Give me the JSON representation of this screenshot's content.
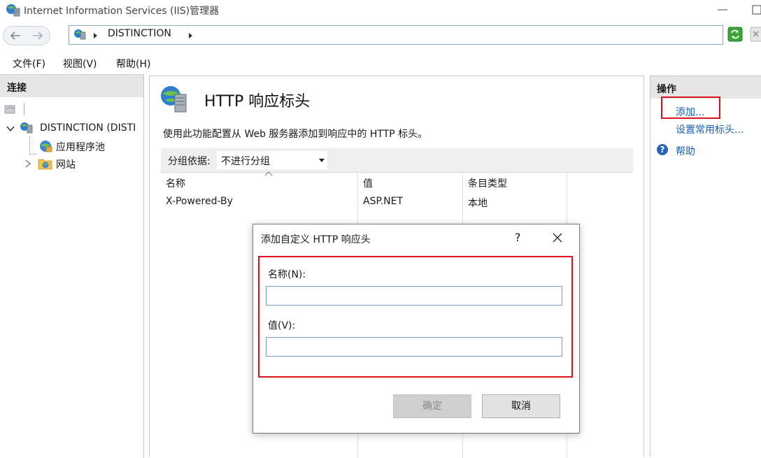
{
  "window": {
    "title": "Internet Information Services (IIS)管理器"
  },
  "address": {
    "segment": "DISTINCTION"
  },
  "menu": [
    "文件(F)",
    "视图(V)",
    "帮助(H)"
  ],
  "connections": {
    "header": "连接",
    "tree": [
      {
        "label": "DISTINCTION (DISTI",
        "expanded": true
      },
      {
        "label": "应用程序池"
      },
      {
        "label": "网站",
        "expanded": false
      }
    ]
  },
  "main": {
    "title": "HTTP 响应标头",
    "description": "使用此功能配置从 Web 服务器添加到响应中的 HTTP 标头。",
    "group_by_label": "分组依据:",
    "group_by_value": "不进行分组",
    "columns": [
      "名称",
      "值",
      "条目类型"
    ],
    "rows": [
      {
        "name": "X-Powered-By",
        "value": "ASP.NET",
        "type": "本地"
      }
    ]
  },
  "actions": {
    "header": "操作",
    "add": "添加...",
    "set_common": "设置常用标头...",
    "help": "帮助"
  },
  "dialog": {
    "title": "添加自定义 HTTP 响应头",
    "help_glyph": "?",
    "name_label": "名称(N):",
    "name_value": "",
    "value_label": "值(V):",
    "value_value": "",
    "ok_label": "确定",
    "cancel_label": "取消"
  },
  "colors": {
    "highlight_box": "#d9121b",
    "link": "#1a5fb4",
    "header_bg": "#e6e6e6"
  }
}
